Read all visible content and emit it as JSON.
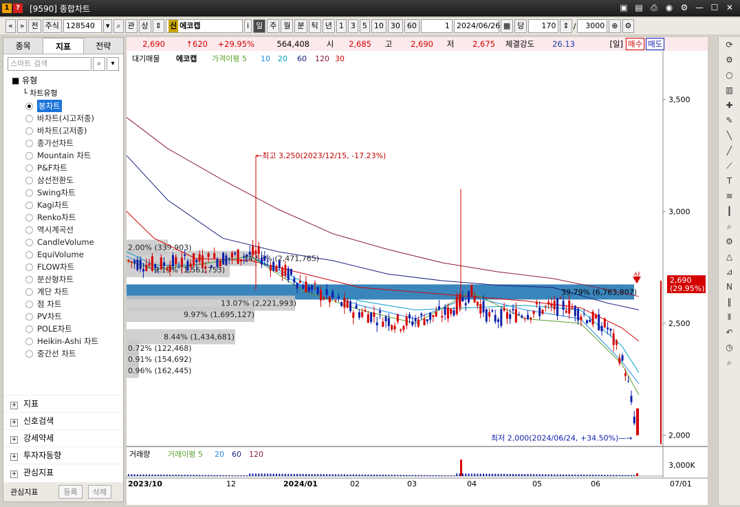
{
  "window": {
    "title": "[9590] 종합차트",
    "num": "1",
    "badge": "?"
  },
  "toolbar": {
    "jeon": "전",
    "jusik": "주식",
    "code": "128540",
    "gwan": "관",
    "sang": "상",
    "sin": "신",
    "stock_name": "에코캡",
    "info": "i",
    "periods": [
      "일",
      "주",
      "월",
      "분",
      "틱",
      "년"
    ],
    "nums": [
      "1",
      "3",
      "5",
      "10",
      "30",
      "60"
    ],
    "count": "1",
    "date": "2024/06/26",
    "dang": "당",
    "view": "170",
    "slash": "/",
    "total": "3000"
  },
  "left": {
    "tabs": [
      "종목",
      "지표",
      "전략"
    ],
    "search_placeholder": "스마트 검색",
    "tree_header": "유형",
    "tree_sub": "차트유형",
    "items": [
      "봉차트",
      "바차트(시고저종)",
      "바차트(고저종)",
      "종가선차트",
      "Mountain 차트",
      "P&F차트",
      "삼선전환도",
      "Swing차트",
      "Kagi차트",
      "Renko차트",
      "역시계곡선",
      "CandleVolume",
      "EquiVolume",
      "FLOW차트",
      "분산형차트",
      "계단 차트",
      "점 차트",
      "PV차트",
      "POLE차트",
      "Heikin-Ashi 차트",
      "중간선 차트"
    ],
    "bottom": [
      "지표",
      "신호검색",
      "강세약세",
      "투자자동향",
      "관심지표"
    ],
    "footer": {
      "label": "관심지표",
      "register": "등록",
      "delete": "삭제"
    }
  },
  "info": {
    "price": "2,690",
    "change": "↑620",
    "pct": "+29.95%",
    "volume": "564,408",
    "open_label": "시",
    "open": "2,685",
    "high_label": "고",
    "high": "2,690",
    "low_label": "저",
    "low": "2,675",
    "strength_label": "체결강도",
    "strength": "26.13",
    "period_label": "[일]",
    "buy": "매수",
    "sell": "매도"
  },
  "legend": {
    "main": "대기매물",
    "name": "에코캡",
    "ma_label": "가격이평 5",
    "ma": [
      "10",
      "20",
      "60",
      "120",
      "30"
    ],
    "vol": "거래량",
    "vol_ma_label": "거래이평 5",
    "vol_ma": [
      "20",
      "60",
      "120"
    ]
  },
  "annotations": {
    "high": "←최고 3,250(2023/12/15, -17.23%)",
    "low": "최저 2,000(2024/06/24, +34.50%)—→",
    "up_label": "상",
    "last_price": "2,690",
    "last_pct": "(29.95%)",
    "vol_axis": "3,000K"
  },
  "colors": {
    "up": "#d40000",
    "down": "#0c1ea8",
    "ma5": "#5aa02c",
    "ma10": "#1e88e5",
    "ma20": "#00a0c8",
    "ma60": "#1a237e",
    "ma120": "#8b1a3a",
    "highlight": "#2f7fb8"
  },
  "chart_data": {
    "type": "candlestick",
    "y_ticks": [
      "3,500",
      "3,000",
      "2,500",
      "2,000"
    ],
    "x_ticks": [
      "2023/10",
      "12",
      "2024/01",
      "02",
      "03",
      "04",
      "05",
      "06",
      "07/01"
    ],
    "ylim": [
      1950,
      3600
    ],
    "volume_profile": [
      {
        "label": "2.00% (339,903)",
        "price": 2840
      },
      {
        "label": "14.55% (2,471,765)",
        "price": 2790
      },
      {
        "label": "9.19% (1,561,753)",
        "price": 2740
      },
      {
        "label": "39.79% (6,763,807)",
        "price": 2640
      },
      {
        "label": "13.07% (2,221,993)",
        "price": 2590
      },
      {
        "label": "9.97% (1,695,127)",
        "price": 2540
      },
      {
        "label": "8.44% (1,434,681)",
        "price": 2440
      },
      {
        "label": "0.72% (122,468)",
        "price": 2390
      },
      {
        "label": "0.91% (154,692)",
        "price": 2340
      },
      {
        "label": "0.96% (162,445)",
        "price": 2290
      }
    ]
  }
}
